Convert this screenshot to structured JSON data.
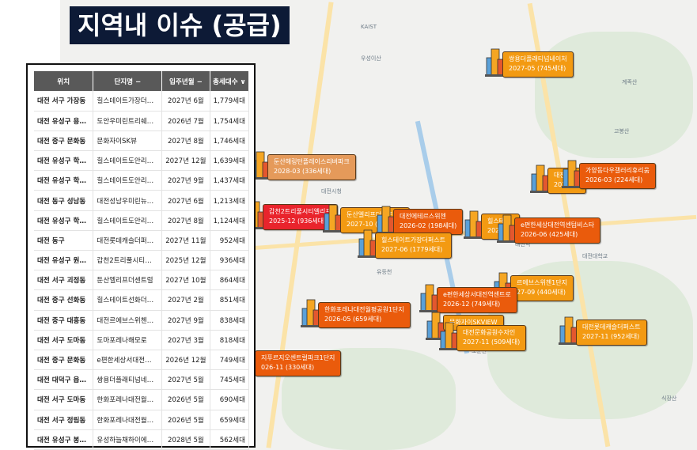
{
  "title": "지역내 이슈 (공급)",
  "table": {
    "headers": [
      "위치",
      "단지명 −",
      "입주년월 −",
      "총세대수 ∨"
    ],
    "rows": [
      [
        "대전 서구 가장동",
        "힐스테이트가장더…",
        "2027년 6월",
        "1,779세대"
      ],
      [
        "대전 유성구 용…",
        "도안우미린트리쉐…",
        "2026년 7월",
        "1,754세대"
      ],
      [
        "대전 중구 문화동",
        "문화자이SK뷰",
        "2027년 8월",
        "1,746세대"
      ],
      [
        "대전 유성구 학…",
        "힐스테이트도안리…",
        "2027년 12월",
        "1,639세대"
      ],
      [
        "대전 유성구 학…",
        "힐스테이트도안리…",
        "2027년 9월",
        "1,437세대"
      ],
      [
        "대전 동구 성남동",
        "대전성남우미린뉴…",
        "2027년 6월",
        "1,213세대"
      ],
      [
        "대전 유성구 학…",
        "힐스테이트도안리…",
        "2027년 8월",
        "1,124세대"
      ],
      [
        "대전 동구",
        "대전롯데캐슬더퍼…",
        "2027년 11월",
        "952세대"
      ],
      [
        "대전 유성구 원…",
        "갑천2트리풀시티…",
        "2025년 12월",
        "936세대"
      ],
      [
        "대전 서구 괴정동",
        "둔산엘리프더센트럴",
        "2027년 10월",
        "864세대"
      ],
      [
        "대전 중구 선화동",
        "힐스테이트선화더…",
        "2027년 2월",
        "851세대"
      ],
      [
        "대전 중구 대흥동",
        "대전르에브스위첸…",
        "2027년 9월",
        "838세대"
      ],
      [
        "대전 서구 도마동",
        "도마포레나해모로",
        "2027년 3월",
        "818세대"
      ],
      [
        "대전 중구 문화동",
        "e편한세상서대전…",
        "2026년 12월",
        "749세대"
      ],
      [
        "대전 대덕구 읍…",
        "쌍용더플래티넘네…",
        "2027년 5월",
        "745세대"
      ],
      [
        "대전 서구 도마동",
        "한화포레나대전월…",
        "2026년 5월",
        "690세대"
      ],
      [
        "대전 서구 정림동",
        "한화포레나대전월…",
        "2026년 5월",
        "659세대"
      ],
      [
        "대전 유성구 봉…",
        "유성하늘채하이에…",
        "2028년 5월",
        "562세대"
      ]
    ]
  },
  "markers": [
    {
      "name": "쌍용더플래티넘네이처",
      "sub": "2027-05 (745세대)",
      "color": "#f39a12"
    },
    {
      "name": "둔산해링턴플레이스리버파크",
      "sub": "2028-03 (336세대)",
      "color": "#e59a5a"
    },
    {
      "name": "갑천2트리풀시티엘리프",
      "sub": "2025-12 (936세대)",
      "color": "#e9242c"
    },
    {
      "name": "둔산엘리프더센트럴",
      "sub": "2027-10 (864세대)",
      "color": "#f39a12"
    },
    {
      "name": "대전에테르스위첸",
      "sub": "2026-02 (198세대)",
      "color": "#ea5b0c"
    },
    {
      "name": "힐스테이트가장더퍼스트",
      "sub": "2027-06 (1779세대)",
      "color": "#f39a12"
    },
    {
      "name": "대전성남",
      "sub": "2027-06",
      "color": "#f39a12"
    },
    {
      "name": "가양동다우갤러리휴리움",
      "sub": "2026-03 (224세대)",
      "color": "#ea5b0c"
    },
    {
      "name": "힐스테이",
      "sub": "2027-02",
      "color": "#f39a12"
    },
    {
      "name": "e편한세상대전역센텀비스타",
      "sub": "2026-06 (425세대)",
      "color": "#ea5b0c"
    },
    {
      "name": "르에브스위첸1단지",
      "sub": "27-09 (440세대)",
      "color": "#f39a12"
    },
    {
      "name": "e편한세상서대전역센트로",
      "sub": "2026-12 (749세대)",
      "color": "#ea5b0c"
    },
    {
      "name": "한화포레나대전월평공원1단지",
      "sub": "2026-05 (659세대)",
      "color": "#ea5b0c"
    },
    {
      "name": "문화자이SKVIEW",
      "sub": "",
      "color": "#f39a12"
    },
    {
      "name": "대전문화공원수자인",
      "sub": "2027-11 (509세대)",
      "color": "#f39a12"
    },
    {
      "name": "대전롯데캐슬더퍼스트",
      "sub": "2027-11 (952세대)",
      "color": "#f39a12"
    },
    {
      "name": "지푸르지오센트럴파크1단지",
      "sub": "026-11 (330세대)",
      "color": "#ea5b0c"
    }
  ],
  "places": [
    "KAIST",
    "우성이산",
    "대전역",
    "대전대학교",
    "보문산",
    "식장산",
    "고봉산",
    "계족산",
    "유등천",
    "대전시청"
  ]
}
